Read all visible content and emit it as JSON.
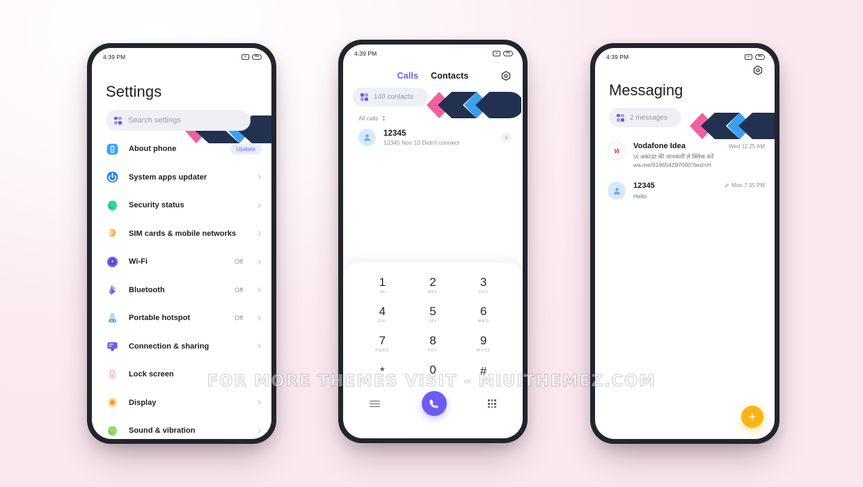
{
  "watermark": "FOR MORE THEMES VISIT - MIUITHEMEZ.COM",
  "colors": {
    "background_pink": "#fbe9ef",
    "frame": "#22252c",
    "accent_purple": "#6b5cf5",
    "ribbon_pink": "#f0609f",
    "ribbon_navy": "#223150",
    "ribbon_blue": "#3aa0f0",
    "fab_amber": "#fcb415",
    "chip_grey": "#eef0f6"
  },
  "status_bar": {
    "time": "4:39 PM",
    "mute_icon": "camera-mute-icon",
    "battery": "45"
  },
  "settings": {
    "title": "Settings",
    "search": {
      "placeholder": "Search settings",
      "icon": "grid-search-icon"
    },
    "items": [
      {
        "label": "About phone",
        "icon": "about-phone-icon",
        "badge": "Update",
        "value": "",
        "chevron": false
      },
      {
        "label": "System apps updater",
        "icon": "updater-icon",
        "badge": "",
        "value": "",
        "chevron": true
      },
      {
        "label": "Security status",
        "icon": "security-icon",
        "badge": "",
        "value": "",
        "chevron": true
      },
      {
        "label": "SIM cards & mobile networks",
        "icon": "sim-card-icon",
        "badge": "",
        "value": "",
        "chevron": true
      },
      {
        "label": "Wi-Fi",
        "icon": "wifi-icon",
        "badge": "",
        "value": "Off",
        "chevron": true
      },
      {
        "label": "Bluetooth",
        "icon": "bluetooth-icon",
        "badge": "",
        "value": "Off",
        "chevron": true
      },
      {
        "label": "Portable hotspot",
        "icon": "hotspot-icon",
        "badge": "",
        "value": "Off",
        "chevron": true
      },
      {
        "label": "Connection & sharing",
        "icon": "connection-icon",
        "badge": "",
        "value": "",
        "chevron": true
      },
      {
        "label": "Lock screen",
        "icon": "lock-screen-icon",
        "badge": "",
        "value": "",
        "chevron": false
      },
      {
        "label": "Display",
        "icon": "display-icon",
        "badge": "",
        "value": "",
        "chevron": true
      },
      {
        "label": "Sound & vibration",
        "icon": "sound-icon",
        "badge": "",
        "value": "",
        "chevron": true
      }
    ]
  },
  "dialer": {
    "tabs": [
      {
        "label": "Calls",
        "active": true
      },
      {
        "label": "Contacts",
        "active": false
      }
    ],
    "settings_icon": "gear-icon",
    "chip": {
      "text": "140 contacts",
      "icon": "grid-search-icon"
    },
    "filter": {
      "label": "All calls",
      "icon": "sort-updown-icon"
    },
    "call_log": [
      {
        "name": "12345",
        "detail": "12345  Nov 10 Didn't connect",
        "avatar": "contact-avatar"
      }
    ],
    "keypad": [
      {
        "digit": "1",
        "sub": "oo",
        "sub_is_voicemail": true
      },
      {
        "digit": "2",
        "sub": "ABC",
        "sub_is_voicemail": false
      },
      {
        "digit": "3",
        "sub": "DEF",
        "sub_is_voicemail": false
      },
      {
        "digit": "4",
        "sub": "GHI",
        "sub_is_voicemail": false
      },
      {
        "digit": "5",
        "sub": "JKL",
        "sub_is_voicemail": false
      },
      {
        "digit": "6",
        "sub": "MNO",
        "sub_is_voicemail": false
      },
      {
        "digit": "7",
        "sub": "PQRS",
        "sub_is_voicemail": false
      },
      {
        "digit": "8",
        "sub": "TUV",
        "sub_is_voicemail": false
      },
      {
        "digit": "9",
        "sub": "WXYZ",
        "sub_is_voicemail": false
      },
      {
        "digit": "*",
        "sub": "",
        "sub_is_voicemail": false
      },
      {
        "digit": "0",
        "sub": "+",
        "sub_is_voicemail": false
      },
      {
        "digit": "#",
        "sub": "",
        "sub_is_voicemail": false
      }
    ],
    "actions": {
      "menu_icon": "hamburger-menu-icon",
      "call_icon": "phone-call-icon",
      "keypad_icon": "dialpad-icon"
    }
  },
  "messaging": {
    "title": "Messaging",
    "settings_icon": "gear-icon",
    "chip": {
      "text": "2 messages",
      "icon": "grid-search-icon"
    },
    "threads": [
      {
        "name": "Vodafone Idea",
        "time": "Wed 11:25 AM",
        "snippet": "Vi अकाउंट की जानकारी ले क्लिक करें wa.me/919654297000?text=H",
        "avatar": "vi-logo",
        "avatar_text": "Vi",
        "draft": false
      },
      {
        "name": "12345",
        "time": "Mon 7:35 PM",
        "snippet": "Hello",
        "avatar": "contact-avatar",
        "avatar_text": "",
        "draft": true
      }
    ],
    "compose": {
      "label": "+",
      "icon": "plus-icon"
    }
  }
}
